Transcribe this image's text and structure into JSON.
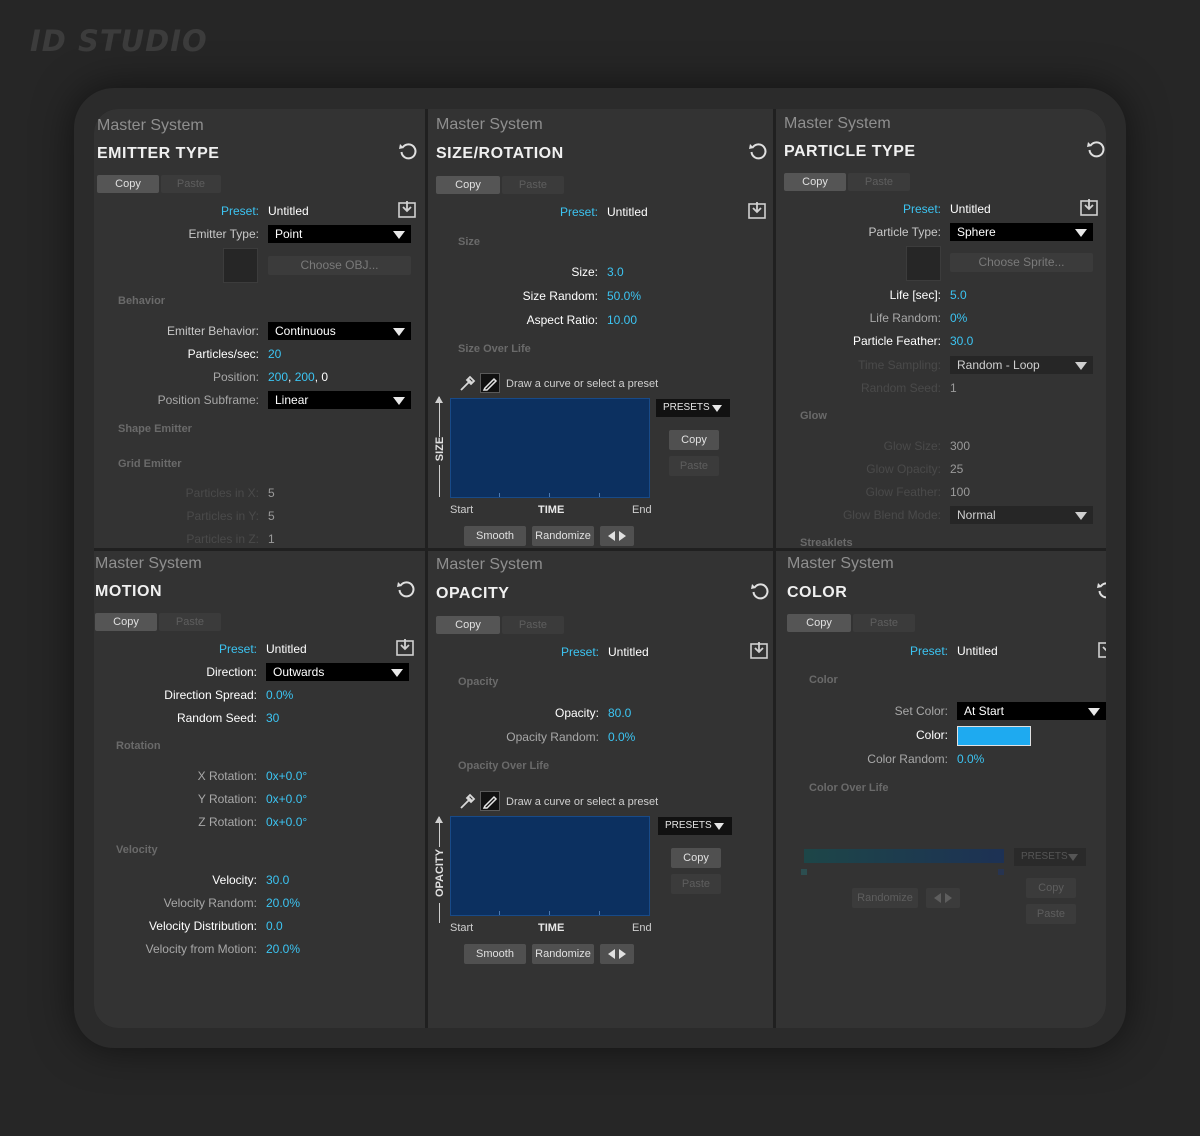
{
  "app": {
    "logo": "ID STUDIO"
  },
  "common": {
    "master": "Master System",
    "copy": "Copy",
    "paste": "Paste",
    "preset_label": "Preset:",
    "preset_value": "Untitled",
    "presets": "PRESETS",
    "smooth": "Smooth",
    "randomize": "Randomize",
    "draw_hint": "Draw a curve or select a preset",
    "start": "Start",
    "time": "TIME",
    "end": "End"
  },
  "emitter": {
    "title": "EMITTER TYPE",
    "emitter_type_label": "Emitter Type:",
    "emitter_type": "Point",
    "choose_obj": "Choose OBJ...",
    "behavior": "Behavior",
    "emitter_behavior_label": "Emitter Behavior:",
    "emitter_behavior": "Continuous",
    "particles_sec_label": "Particles/sec:",
    "particles_sec": "20",
    "position_label": "Position:",
    "position_x": "200",
    "position_y": "200",
    "position_z": "0",
    "position_subframe_label": "Position Subframe:",
    "position_subframe": "Linear",
    "shape_emitter": "Shape Emitter",
    "grid_emitter": "Grid Emitter",
    "px_label": "Particles in X:",
    "px": "5",
    "py_label": "Particles in Y:",
    "py": "5",
    "pz_label": "Particles in Z:",
    "pz": "1"
  },
  "size": {
    "title": "SIZE/ROTATION",
    "section": "Size",
    "size_label": "Size:",
    "size": "3.0",
    "size_random_label": "Size Random:",
    "size_random": "50.0%",
    "aspect_label": "Aspect Ratio:",
    "aspect": "10.00",
    "over_life": "Size Over Life",
    "axis": "SIZE"
  },
  "particle": {
    "title": "PARTICLE TYPE",
    "particle_type_label": "Particle Type:",
    "particle_type": "Sphere",
    "choose_sprite": "Choose Sprite...",
    "life_label": "Life [sec]:",
    "life": "5.0",
    "life_random_label": "Life Random:",
    "life_random": "0%",
    "feather_label": "Particle Feather:",
    "feather": "30.0",
    "time_sampling_label": "Time Sampling:",
    "time_sampling": "Random - Loop",
    "random_seed_label": "Random Seed:",
    "random_seed": "1",
    "glow": "Glow",
    "glow_size_label": "Glow Size:",
    "glow_size": "300",
    "glow_opacity_label": "Glow Opacity:",
    "glow_opacity": "25",
    "glow_feather_label": "Glow Feather:",
    "glow_feather": "100",
    "glow_blend_label": "Glow Blend Mode:",
    "glow_blend": "Normal",
    "streaklets": "Streaklets"
  },
  "motion": {
    "title": "MOTION",
    "direction_label": "Direction:",
    "direction": "Outwards",
    "direction_spread_label": "Direction Spread:",
    "direction_spread": "0.0%",
    "random_seed_label": "Random Seed:",
    "random_seed": "30",
    "rotation": "Rotation",
    "xrot_label": "X Rotation:",
    "xrot": "0x+0.0°",
    "yrot_label": "Y Rotation:",
    "yrot": "0x+0.0°",
    "zrot_label": "Z Rotation:",
    "zrot": "0x+0.0°",
    "velocity_section": "Velocity",
    "velocity_label": "Velocity:",
    "velocity": "30.0",
    "velocity_random_label": "Velocity Random:",
    "velocity_random": "20.0%",
    "velocity_dist_label": "Velocity Distribution:",
    "velocity_dist": "0.0",
    "velocity_motion_label": "Velocity from Motion:",
    "velocity_motion": "20.0%"
  },
  "opacity": {
    "title": "OPACITY",
    "section": "Opacity",
    "opacity_label": "Opacity:",
    "opacity": "80.0",
    "opacity_random_label": "Opacity Random:",
    "opacity_random": "0.0%",
    "over_life": "Opacity Over Life",
    "axis": "OPACITY"
  },
  "color": {
    "title": "COLOR",
    "section": "Color",
    "set_color_label": "Set Color:",
    "set_color": "At Start",
    "color_label": "Color:",
    "color_value": "#1eaaf0",
    "color_random_label": "Color Random:",
    "color_random": "0.0%",
    "over_life": "Color Over Life"
  },
  "colors": {
    "accent": "#3cc4f2",
    "graph": "#0c3060",
    "panel": "#333333"
  }
}
